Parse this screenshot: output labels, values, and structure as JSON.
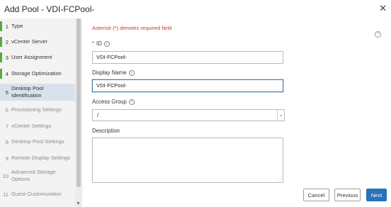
{
  "dialog": {
    "title": "Add Pool - VDI-FCPool-"
  },
  "steps": [
    {
      "num": "1",
      "label": "Type",
      "state": "done"
    },
    {
      "num": "2",
      "label": "vCenter Server",
      "state": "done"
    },
    {
      "num": "3",
      "label": "User Assignment",
      "state": "done"
    },
    {
      "num": "4",
      "label": "Storage Optimization",
      "state": "done"
    },
    {
      "num": "5",
      "label": "Desktop Pool Identification",
      "state": "current"
    },
    {
      "num": "6",
      "label": "Provisioning Settings",
      "state": "pending"
    },
    {
      "num": "7",
      "label": "vCenter Settings",
      "state": "pending"
    },
    {
      "num": "8",
      "label": "Desktop Pool Settings",
      "state": "pending"
    },
    {
      "num": "9",
      "label": "Remote Display Settings",
      "state": "pending"
    },
    {
      "num": "10",
      "label": "Advanced Storage Options",
      "state": "pending"
    },
    {
      "num": "11",
      "label": "Guest Customization",
      "state": "pending"
    }
  ],
  "form": {
    "required_note": "Asterisk (*) denotes required field",
    "id_label": "ID",
    "id_required_mark": "*",
    "id_value": "VDI-FCPool-",
    "display_name_label": "Display Name",
    "display_name_value": "VDI-FCPool-",
    "access_group_label": "Access Group",
    "access_group_value": "/",
    "description_label": "Description",
    "description_value": ""
  },
  "buttons": {
    "cancel": "Cancel",
    "previous": "Previous",
    "next": "Next"
  },
  "icons": {
    "help": "help-circle-icon",
    "info": "info-icon",
    "close": "close-icon"
  },
  "colors": {
    "primary": "#2a71b8",
    "done_step": "#5aa845",
    "current_step_bg": "#d8e1ec",
    "required": "#c63a3a"
  }
}
